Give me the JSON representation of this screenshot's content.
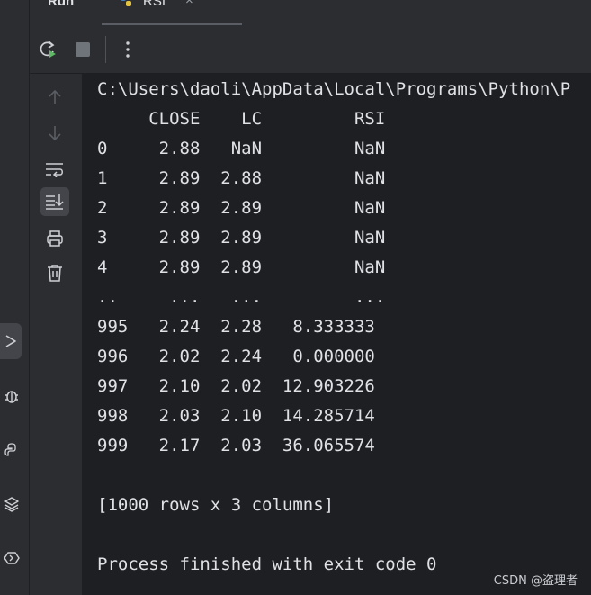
{
  "tabs": {
    "run_title": "Run",
    "active_tab_label": "RSI",
    "close_glyph": "×"
  },
  "toolbar": {
    "rerun_icon": "rerun-icon",
    "stop_icon": "stop-icon",
    "more_icon": "more-vertical-icon"
  },
  "run_sidebar": {
    "icons": [
      "arrow-up-icon",
      "arrow-down-icon",
      "soft-wrap-icon",
      "scroll-to-end-icon",
      "print-icon",
      "trash-icon"
    ],
    "selected": "scroll-to-end-icon"
  },
  "left_strip": {
    "icons": [
      "run-icon",
      "debug-icon",
      "python-console-icon",
      "layers-icon",
      "services-icon"
    ],
    "active": "run-icon"
  },
  "console": {
    "lines": [
      "C:\\Users\\daoli\\AppData\\Local\\Programs\\Python\\P",
      "     CLOSE    LC         RSI",
      "0     2.88   NaN         NaN",
      "1     2.89  2.88         NaN",
      "2     2.89  2.89         NaN",
      "3     2.89  2.89         NaN",
      "4     2.89  2.89         NaN",
      "..     ...   ...         ...",
      "995   2.24  2.28   8.333333",
      "996   2.02  2.24   0.000000",
      "997   2.10  2.02  12.903226",
      "998   2.03  2.10  14.285714",
      "999   2.17  2.03  36.065574",
      "",
      "[1000 rows x 3 columns]",
      "",
      "Process finished with exit code 0"
    ]
  },
  "watermark": "CSDN @盗理者",
  "colors": {
    "console_bg": "#1e1f22",
    "panel_bg": "#2b2d30",
    "text": "#dfe1e5",
    "icon": "#ced0d6",
    "rerun_accent": "#5fb865"
  }
}
